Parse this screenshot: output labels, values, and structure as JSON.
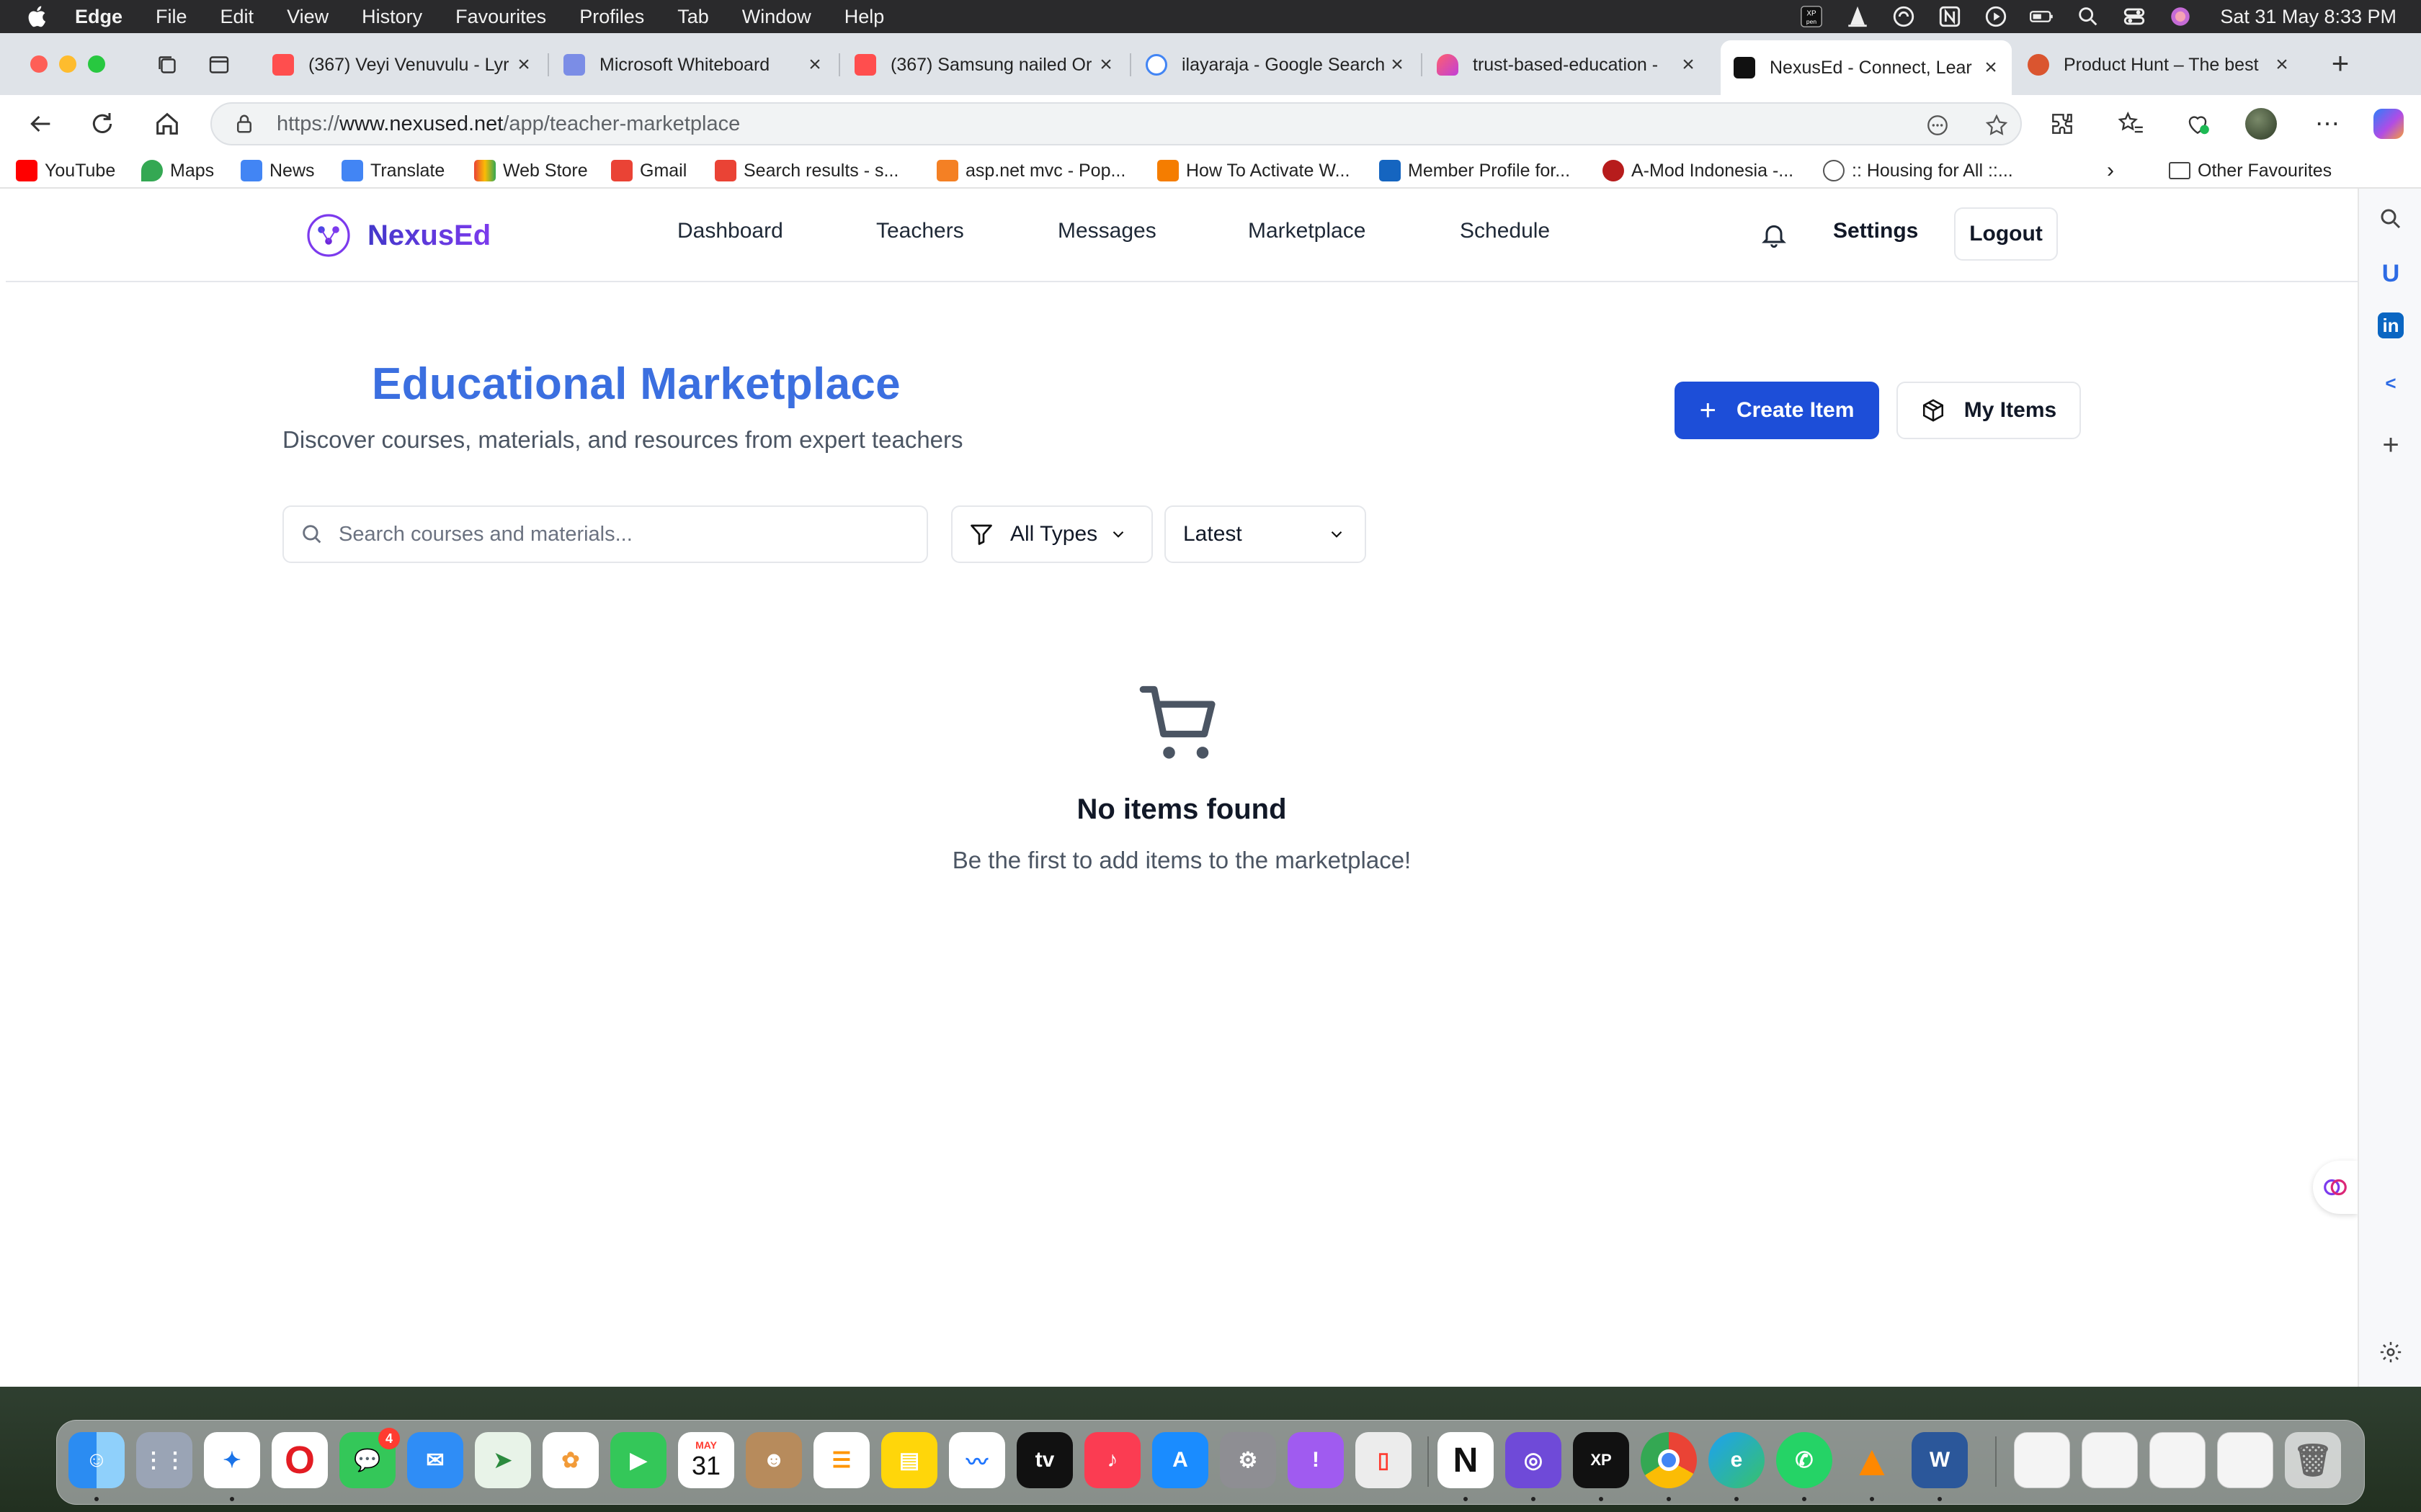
{
  "menubar": {
    "app_name": "Edge",
    "items": [
      "File",
      "Edit",
      "View",
      "History",
      "Favourites",
      "Profiles",
      "Tab",
      "Window",
      "Help"
    ],
    "clock": "Sat 31 May  8:33 PM"
  },
  "tabs": [
    {
      "title": "(367) Veyi Venuvulu - Lyr",
      "favicon_color": "#ff4e4e"
    },
    {
      "title": "Microsoft Whiteboard",
      "favicon_color": "#7b8de6"
    },
    {
      "title": "(367) Samsung nailed Or",
      "favicon_color": "#ff4e4e"
    },
    {
      "title": "ilayaraja - Google Search",
      "favicon_color": "#4285f4"
    },
    {
      "title": "trust-based-education -",
      "favicon_color": "#c13fd8"
    },
    {
      "title": "NexusEd - Connect, Lear",
      "favicon_color": "#111111",
      "active": true
    },
    {
      "title": "Product Hunt – The best",
      "favicon_color": "#da552f"
    }
  ],
  "address": {
    "prefix": "https://",
    "domain": "www.nexused.net",
    "path": "/app/teacher-marketplace"
  },
  "bookmarks": [
    {
      "label": "YouTube",
      "color": "#ff0000"
    },
    {
      "label": "Maps",
      "color": "#34a853"
    },
    {
      "label": "News",
      "color": "#4285f4"
    },
    {
      "label": "Translate",
      "color": "#4285f4"
    },
    {
      "label": "Web Store",
      "color": "#fbbc05"
    },
    {
      "label": "Gmail",
      "color": "#ea4335"
    },
    {
      "label": "Search results - s...",
      "color": "#ea4335"
    },
    {
      "label": "asp.net mvc - Pop...",
      "color": "#f48024"
    },
    {
      "label": "How To Activate W...",
      "color": "#f57d00"
    },
    {
      "label": "Member Profile for...",
      "color": "#1565c0"
    },
    {
      "label": "A-Mod Indonesia -...",
      "color": "#b71c1c"
    },
    {
      "label": ":: Housing for All ::...",
      "color": "#555555"
    }
  ],
  "other_favourites": "Other Favourites",
  "app": {
    "logo_text": "NexusEd",
    "nav": [
      "Dashboard",
      "Teachers",
      "Messages",
      "Marketplace",
      "Schedule"
    ],
    "settings_label": "Settings",
    "logout_label": "Logout"
  },
  "marketplace": {
    "title": "Educational Marketplace",
    "subtitle": "Discover courses, materials, and resources from expert teachers",
    "create_label": "Create Item",
    "my_items_label": "My Items",
    "search_placeholder": "Search courses and materials...",
    "type_filter": "All Types",
    "sort": "Latest",
    "empty_title": "No items found",
    "empty_subtitle": "Be the first to add items to the marketplace!"
  },
  "dock": {
    "messages_badge": "4",
    "calendar_month": "MAY",
    "calendar_day": "31"
  },
  "colors": {
    "primary": "#1d4ed8",
    "heading": "#3b6fe0",
    "logo_gradient_start": "#4338ca",
    "logo_gradient_end": "#7c3aed"
  }
}
